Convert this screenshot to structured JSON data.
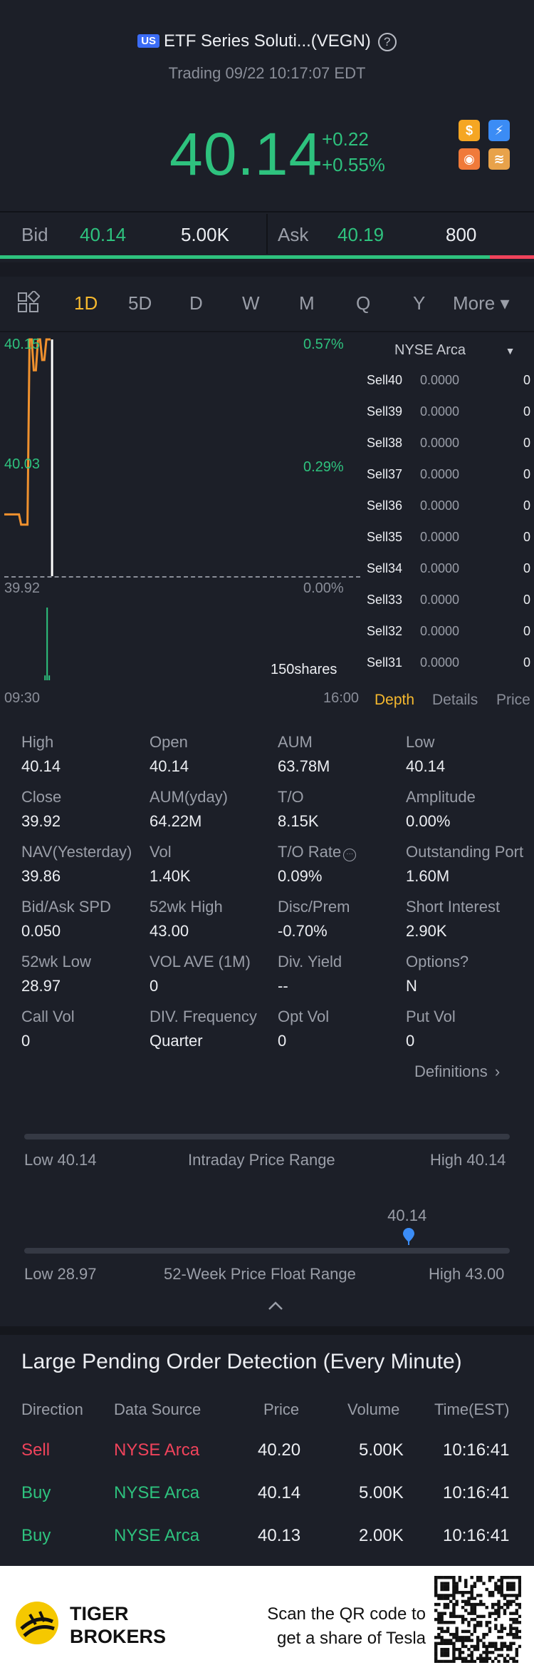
{
  "header": {
    "market_badge": "US",
    "title": "ETF Series Soluti...(VEGN)",
    "subtitle": "Trading 09/22 10:17:07 EDT",
    "help": "?"
  },
  "quote": {
    "price": "40.14",
    "change": "+0.22",
    "change_pct": "+0.55%",
    "badges": [
      {
        "glyph": "$",
        "color": "#f5a623"
      },
      {
        "glyph": "⚡",
        "color": "#3b8cf5"
      },
      {
        "glyph": "◉",
        "color": "#f07a3a"
      },
      {
        "glyph": "≋",
        "color": "#e8a24a"
      }
    ]
  },
  "bidask": {
    "bid_label": "Bid",
    "bid_price": "40.14",
    "bid_size": "5.00K",
    "ask_label": "Ask",
    "ask_price": "40.19",
    "ask_size": "800",
    "bid_fraction": 0.917
  },
  "periods": {
    "active": "1D",
    "items": [
      "1D",
      "5D",
      "D",
      "W",
      "M",
      "Q",
      "Y",
      "More ▾"
    ]
  },
  "chart": {
    "top_price": "40.15",
    "mid_price": "40.03",
    "base_price": "39.92",
    "top_pct": "0.57%",
    "mid_pct": "0.29%",
    "base_pct": "0.00%",
    "volume_label": "150shares",
    "time_start": "09:30",
    "time_end": "16:00"
  },
  "chart_data": {
    "type": "line",
    "x": [
      "09:30",
      "09:31",
      "09:32",
      "09:33",
      "09:34",
      "09:35",
      "09:36",
      "09:37",
      "09:38",
      "09:39",
      "09:40",
      "09:41",
      "09:42",
      "09:43",
      "09:44",
      "09:45",
      "09:46",
      "09:47",
      "09:48",
      "09:49",
      "09:50",
      "09:51",
      "09:52"
    ],
    "series": [
      {
        "values": [
          39.98,
          39.98,
          39.98,
          39.98,
          39.98,
          39.98,
          39.98,
          39.98,
          39.97,
          39.97,
          39.97,
          39.97,
          40.15,
          40.15,
          40.12,
          40.12,
          40.15,
          40.15,
          40.13,
          40.13,
          40.15,
          40.15,
          40.15
        ]
      }
    ],
    "ylim": [
      39.92,
      40.15
    ],
    "volume": [
      0,
      0,
      0,
      0,
      0,
      0,
      0,
      0,
      0,
      0,
      0,
      0,
      0,
      0,
      0,
      0,
      0,
      0,
      0,
      10,
      150,
      10,
      0
    ],
    "x_ticks": [
      "09:30",
      "16:00"
    ],
    "prev_close": 39.92
  },
  "depth": {
    "exchange": "NYSE Arca",
    "rows": [
      {
        "label": "Sell40",
        "price": "0.0000",
        "qty": "0"
      },
      {
        "label": "Sell39",
        "price": "0.0000",
        "qty": "0"
      },
      {
        "label": "Sell38",
        "price": "0.0000",
        "qty": "0"
      },
      {
        "label": "Sell37",
        "price": "0.0000",
        "qty": "0"
      },
      {
        "label": "Sell36",
        "price": "0.0000",
        "qty": "0"
      },
      {
        "label": "Sell35",
        "price": "0.0000",
        "qty": "0"
      },
      {
        "label": "Sell34",
        "price": "0.0000",
        "qty": "0"
      },
      {
        "label": "Sell33",
        "price": "0.0000",
        "qty": "0"
      },
      {
        "label": "Sell32",
        "price": "0.0000",
        "qty": "0"
      },
      {
        "label": "Sell31",
        "price": "0.0000",
        "qty": "0"
      }
    ],
    "tabs": [
      "Depth",
      "Details",
      "Price"
    ]
  },
  "stats": [
    [
      {
        "l": "High",
        "v": "40.14"
      },
      {
        "l": "Open",
        "v": "40.14"
      },
      {
        "l": "AUM",
        "v": "63.78M"
      },
      {
        "l": "Low",
        "v": "40.14"
      }
    ],
    [
      {
        "l": "Close",
        "v": "39.92"
      },
      {
        "l": "AUM(yday)",
        "v": "64.22M"
      },
      {
        "l": "T/O",
        "v": "8.15K"
      },
      {
        "l": "Amplitude",
        "v": "0.00%"
      }
    ],
    [
      {
        "l": "NAV(Yesterday)",
        "v": "39.86"
      },
      {
        "l": "Vol",
        "v": "1.40K"
      },
      {
        "l": "T/O Rate",
        "v": "0.09%"
      },
      {
        "l": "Outstanding Port",
        "v": "1.60M"
      }
    ],
    [
      {
        "l": "Bid/Ask SPD",
        "v": "0.050"
      },
      {
        "l": "52wk High",
        "v": "43.00"
      },
      {
        "l": "Disc/Prem",
        "v": "-0.70%"
      },
      {
        "l": "Short Interest",
        "v": "2.90K"
      }
    ],
    [
      {
        "l": "52wk Low",
        "v": "28.97"
      },
      {
        "l": "VOL AVE (1M)",
        "v": "0"
      },
      {
        "l": "Div. Yield",
        "v": "--"
      },
      {
        "l": "Options?",
        "v": "N"
      }
    ],
    [
      {
        "l": "Call Vol",
        "v": "0"
      },
      {
        "l": "DIV. Frequency",
        "v": "Quarter"
      },
      {
        "l": "Opt Vol",
        "v": "0"
      },
      {
        "l": "Put Vol",
        "v": "0"
      }
    ]
  ],
  "definitions": "Definitions",
  "intraday": {
    "low": "Low 40.14",
    "title": "Intraday Price Range",
    "high": "High 40.14"
  },
  "week52": {
    "marker": "40.14",
    "low": "Low 28.97",
    "title": "52-Week Price Float Range",
    "high": "High 43.00",
    "position": 0.792
  },
  "large_orders": {
    "title": "Large Pending Order Detection (Every Minute)",
    "headers": [
      "Direction",
      "Data Source",
      "Price",
      "Volume",
      "Time(EST)"
    ],
    "rows": [
      {
        "dir": "Sell",
        "src": "NYSE Arca",
        "price": "40.20",
        "vol": "5.00K",
        "time": "10:16:41"
      },
      {
        "dir": "Buy",
        "src": "NYSE Arca",
        "price": "40.14",
        "vol": "5.00K",
        "time": "10:16:41"
      },
      {
        "dir": "Buy",
        "src": "NYSE Arca",
        "price": "40.13",
        "vol": "2.00K",
        "time": "10:16:41"
      }
    ]
  },
  "footer": {
    "brand_line1": "TIGER",
    "brand_line2": "BROKERS",
    "cta_line1": "Scan the QR code to",
    "cta_line2": "get a share of Tesla"
  }
}
